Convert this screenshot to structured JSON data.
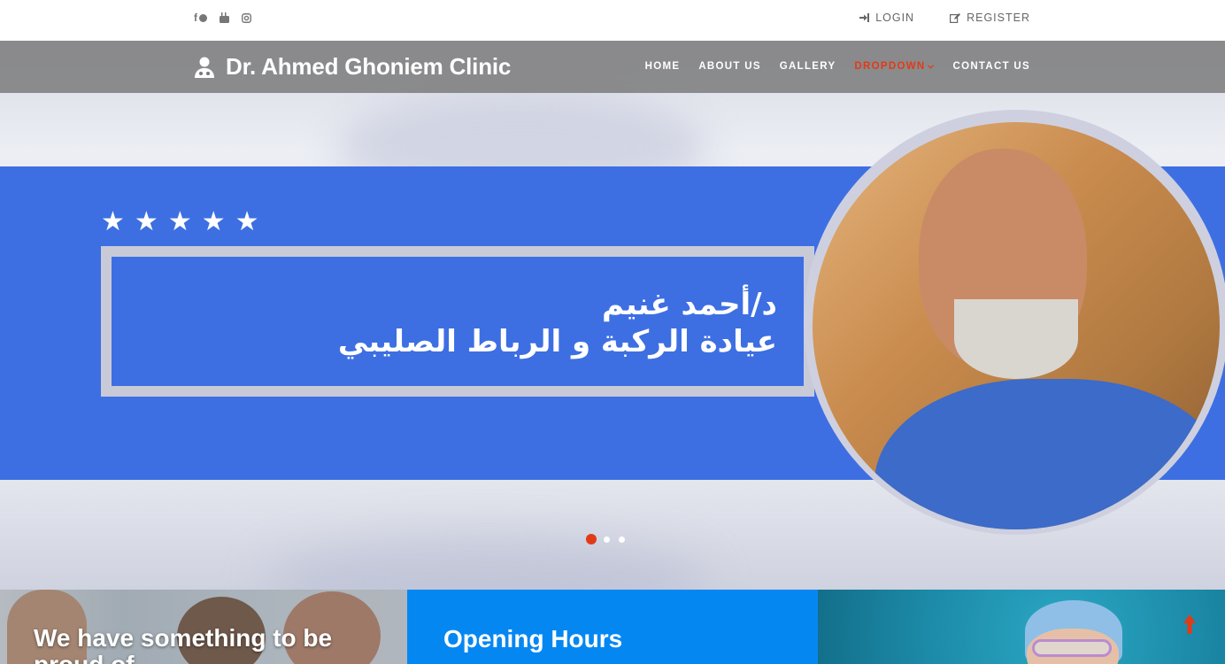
{
  "topbar": {
    "social": [
      {
        "name": "facebook-messenger",
        "icon": "facebook-icon"
      },
      {
        "name": "youtube",
        "icon": "youtube-icon"
      },
      {
        "name": "instagram",
        "icon": "instagram-icon"
      }
    ],
    "login_label": "LOGIN",
    "register_label": "REGISTER"
  },
  "navbar": {
    "brand": "Dr. Ahmed Ghoniem Clinic",
    "brand_icon": "doctor-icon",
    "links": [
      "HOME",
      "ABOUT US",
      "GALLERY",
      "DROPDOWN",
      "CONTACT US"
    ],
    "active_link": "DROPDOWN"
  },
  "hero": {
    "rating_stars": 5,
    "line1": "د/أحمد غنيم",
    "line2": "عيادة الركبة و الرباط الصليبي",
    "slides": 3,
    "active_slide": 1
  },
  "panels": {
    "p1_title": "We have something to be proud of",
    "p2_title": "Opening Hours"
  },
  "colors": {
    "accent": "#e23a17",
    "hero_blue": "#3d6fe3",
    "panel_blue": "#0587f2",
    "navbar": "#787878"
  }
}
